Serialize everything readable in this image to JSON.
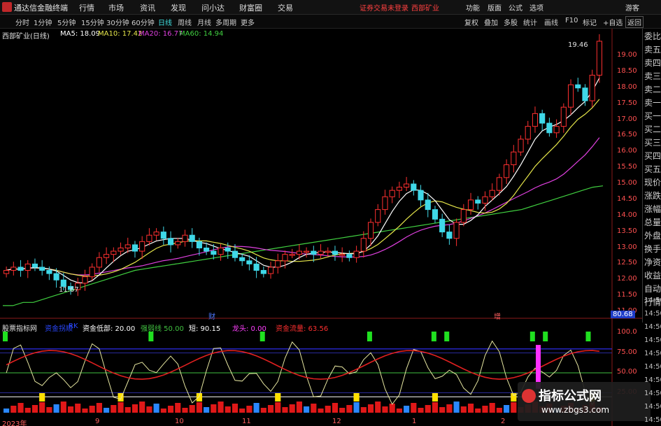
{
  "titlebar": {
    "app_title": "通达信金融终端",
    "menus": [
      "行情",
      "市场",
      "资讯",
      "发现",
      "问小达",
      "财富圈",
      "交易"
    ],
    "notice": "证券交易未登录",
    "stock": "西部矿业",
    "tools": [
      "功能",
      "版面",
      "公式",
      "选项"
    ],
    "guest": "游客"
  },
  "periods": {
    "items": [
      "分时",
      "1分钟",
      "5分钟",
      "15分钟",
      "30分钟",
      "60分钟",
      "日线",
      "周线",
      "月线",
      "多周期",
      "更多"
    ],
    "active": "日线",
    "right_items": [
      "复权",
      "叠加",
      "多股",
      "统计",
      "画线",
      "F10",
      "标记",
      "+自选",
      "返回"
    ]
  },
  "legend": {
    "name": "西部矿业(日线)",
    "ma5": "MA5: 18.09",
    "ma10": "MA10: 17.42",
    "ma20": "MA20: 16.77",
    "ma60": "MA60: 14.94",
    "colors": {
      "ma5": "#ffffff",
      "ma10": "#e6e64a",
      "ma20": "#e040e0",
      "ma60": "#40d040"
    }
  },
  "annotations": {
    "high": "19.46",
    "low": "11.67",
    "marker1": "财",
    "marker2": "增"
  },
  "price_axis": [
    "19.00",
    "18.50",
    "18.00",
    "17.50",
    "17.00",
    "16.50",
    "16.00",
    "15.50",
    "15.00",
    "14.50",
    "14.00",
    "13.50",
    "13.00",
    "12.50",
    "12.00",
    "11.50",
    "11.00"
  ],
  "right_panel": [
    "委比",
    "卖五",
    "卖四",
    "卖三",
    "卖二",
    "卖一",
    "买一",
    "买二",
    "买三",
    "买四",
    "买五",
    "现价",
    "涨跌",
    "涨幅",
    "总量",
    "外盘",
    "换手",
    "净资",
    "收益",
    "自动",
    "行情"
  ],
  "indicator": {
    "name": "股票指标网",
    "items": [
      {
        "label": "资金拐顺",
        "value": "",
        "color": "#2a48ff"
      },
      {
        "label": "RK",
        "value": "",
        "color": "#2a48ff"
      },
      {
        "label": "资金低部:",
        "value": "20.00",
        "color": "#ffffff"
      },
      {
        "label": "强弱线",
        "value": "50.00",
        "color": "#40c040"
      },
      {
        "label": "短:",
        "value": "90.15",
        "color": "#ffffff"
      },
      {
        "label": "龙头:",
        "value": "0.00",
        "color": "#ff40ff"
      },
      {
        "label": "资金流量:",
        "value": "63.56",
        "color": "#ff3030"
      }
    ],
    "axis": [
      "100.0",
      "75.00",
      "50.00",
      "25.00"
    ],
    "current": "80.68"
  },
  "time_axis": [
    "2023年",
    "9",
    "10",
    "11",
    "12",
    "1",
    "2"
  ],
  "right_time_labels": [
    "14:50",
    "14:50",
    "14:50",
    "14:50",
    "14:50",
    "14:50",
    "14:50",
    "14:50",
    "14:50",
    "14:50"
  ],
  "watermark": {
    "title": "指标公式网",
    "url": "www.zbgs3.com"
  },
  "chart_data": {
    "type": "candlestick",
    "title": "西部矿业(日线)",
    "ylim": [
      11.0,
      19.5
    ],
    "ma_labels": {
      "MA5": 18.09,
      "MA10": 17.42,
      "MA20": 16.77,
      "MA60": 14.94
    },
    "approx_closes": [
      12.3,
      12.4,
      12.3,
      12.5,
      12.4,
      12.3,
      12.2,
      12.0,
      11.8,
      11.7,
      11.9,
      12.1,
      12.4,
      12.7,
      12.8,
      12.9,
      13.0,
      13.1,
      12.9,
      13.2,
      13.4,
      13.5,
      13.3,
      13.1,
      13.2,
      13.4,
      13.2,
      13.0,
      12.9,
      12.8,
      13.0,
      12.9,
      12.7,
      12.6,
      12.5,
      12.3,
      12.2,
      12.4,
      12.6,
      12.8,
      12.8,
      12.9,
      12.9,
      12.8,
      12.9,
      12.9,
      12.8,
      12.8,
      12.7,
      12.9,
      13.3,
      13.8,
      14.2,
      14.6,
      14.8,
      14.9,
      15.0,
      14.8,
      14.5,
      14.2,
      13.9,
      13.5,
      13.3,
      13.8,
      14.2,
      14.5,
      14.4,
      14.6,
      14.8,
      15.2,
      15.6,
      16.0,
      16.4,
      16.8,
      17.2,
      16.9,
      16.6,
      16.8,
      17.4,
      18.1,
      18.0,
      17.6,
      18.4,
      19.46
    ],
    "approx_ma60": [
      11.2,
      11.2,
      11.3,
      11.3,
      11.4,
      11.5,
      11.6,
      11.7,
      11.8,
      11.9,
      12.0,
      12.1,
      12.2,
      12.3,
      12.35,
      12.4,
      12.45,
      12.5,
      12.55,
      12.6,
      12.65,
      12.7,
      12.75,
      12.8,
      12.85,
      12.9,
      12.95,
      13.0,
      13.05,
      13.1,
      13.15,
      13.2,
      13.25,
      13.3,
      13.35,
      13.4,
      13.45,
      13.5,
      13.55,
      13.6,
      13.65,
      13.7,
      13.75,
      13.8,
      13.85,
      13.9,
      13.95,
      14.0,
      14.05,
      14.1,
      14.15,
      14.2,
      14.3,
      14.4,
      14.5,
      14.6,
      14.7,
      14.8,
      14.9,
      14.94
    ]
  }
}
